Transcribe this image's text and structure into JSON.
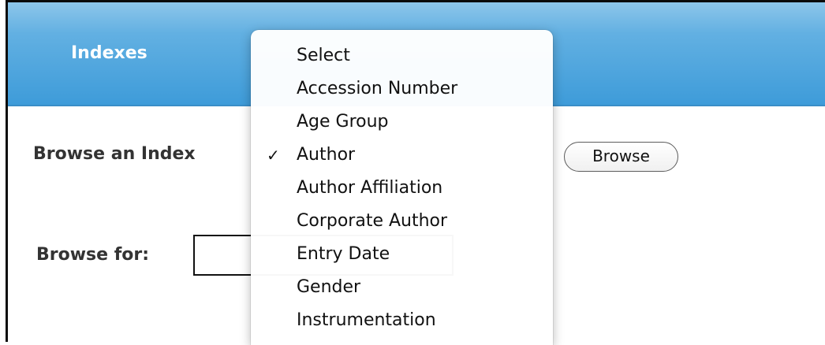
{
  "header": {
    "title": "Indexes"
  },
  "form": {
    "browse_index_label": "Browse an Index",
    "browse_for_label": "Browse for:",
    "browse_button_label": "Browse",
    "browse_for_value": ""
  },
  "dropdown": {
    "selected": "Author",
    "check_glyph": "✓",
    "options": [
      "Select",
      "Accession Number",
      "Age Group",
      "Author",
      "Author Affiliation",
      "Corporate Author",
      "Entry Date",
      "Gender",
      "Instrumentation"
    ]
  },
  "colors": {
    "header_blue": "#3d9bd9",
    "header_text": "#ffffff",
    "label_text": "#333333"
  }
}
